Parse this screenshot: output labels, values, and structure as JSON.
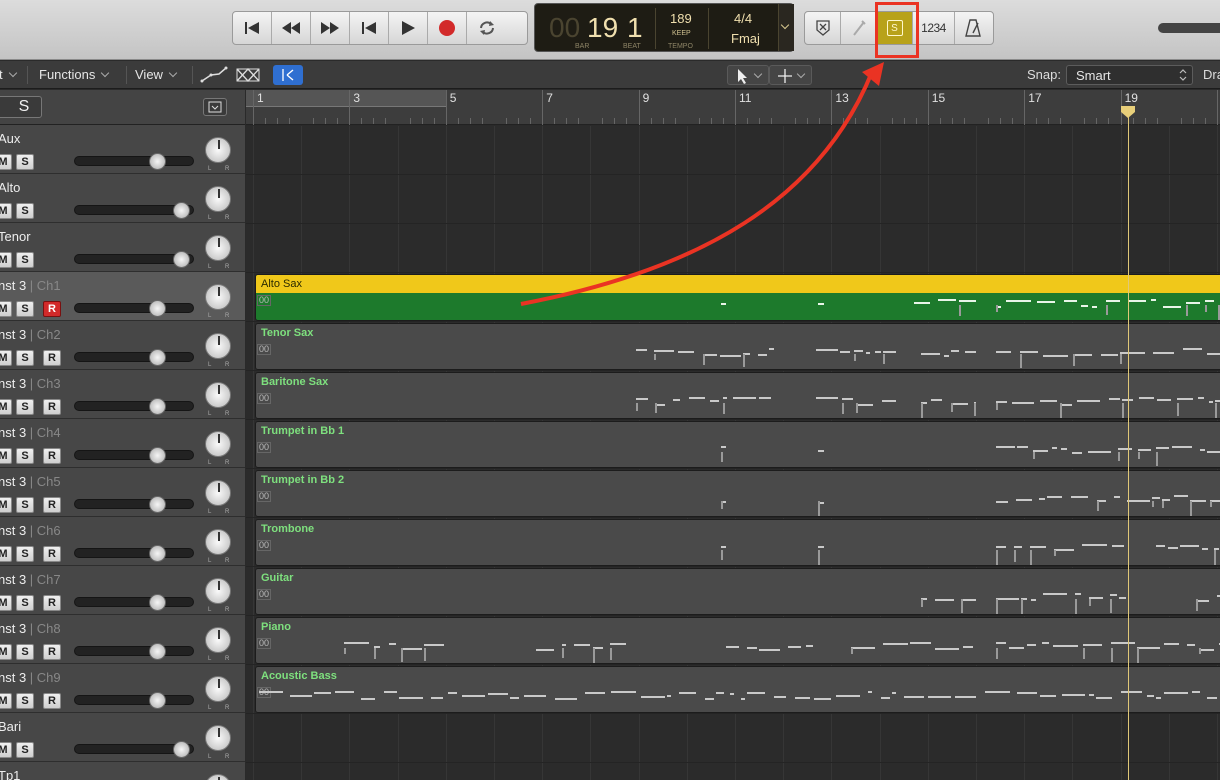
{
  "lcd": {
    "bar_prefix": "00",
    "bar": "19",
    "beat": "1",
    "bar_label": "BAR",
    "beat_label": "BEAT",
    "tempo": "189",
    "keep_label": "KEEP",
    "tempo_label": "TEMPO",
    "time_signature": "4/4",
    "key": "Fmaj"
  },
  "controls": {
    "count_in": "1234",
    "solo_button": "S"
  },
  "toolbar": {
    "edit_menu": "t",
    "functions_menu": "Functions",
    "view_menu": "View",
    "snap_label": "Snap:",
    "snap_value": "Smart",
    "drag_label": "Dra"
  },
  "header": {
    "solo_label": "S"
  },
  "buttons": {
    "mute": "M",
    "solo": "S",
    "rec": "R",
    "left": "L",
    "right": "R"
  },
  "ruler": {
    "bars": [
      "1",
      "3",
      "5",
      "7",
      "9",
      "11",
      "13",
      "15",
      "17",
      "19",
      "2"
    ]
  },
  "tracks": [
    {
      "name": "Aux",
      "channel": ""
    },
    {
      "name": "Alto",
      "channel": ""
    },
    {
      "name": "Tenor",
      "channel": ""
    },
    {
      "name": "nst 3",
      "channel": " | Ch1"
    },
    {
      "name": "nst 3",
      "channel": " | Ch2"
    },
    {
      "name": "nst 3",
      "channel": " | Ch3"
    },
    {
      "name": "nst 3",
      "channel": " | Ch4"
    },
    {
      "name": "nst 3",
      "channel": " | Ch5"
    },
    {
      "name": "nst 3",
      "channel": " | Ch6"
    },
    {
      "name": "nst 3",
      "channel": " | Ch7"
    },
    {
      "name": "nst 3",
      "channel": " | Ch8"
    },
    {
      "name": "nst 3",
      "channel": " | Ch9"
    },
    {
      "name": "Bari",
      "channel": ""
    },
    {
      "name": "Tp1",
      "channel": ""
    }
  ],
  "regions": [
    {
      "name": "Alto Sax",
      "pin": "00"
    },
    {
      "name": "Tenor Sax",
      "pin": "00"
    },
    {
      "name": "Baritone Sax",
      "pin": "00"
    },
    {
      "name": "Trumpet in Bb 1",
      "pin": "00"
    },
    {
      "name": "Trumpet in Bb 2",
      "pin": "00"
    },
    {
      "name": "Trombone",
      "pin": "00"
    },
    {
      "name": "Guitar",
      "pin": "00"
    },
    {
      "name": "Piano",
      "pin": "00"
    },
    {
      "name": "Acoustic Bass",
      "pin": "00"
    }
  ],
  "colors": {
    "annotation": "#ea3323",
    "selected_region": "#1d7a2c",
    "selected_region_header": "#f0c81a",
    "solo_active": "#b8a21a",
    "record": "#d22a2a"
  }
}
